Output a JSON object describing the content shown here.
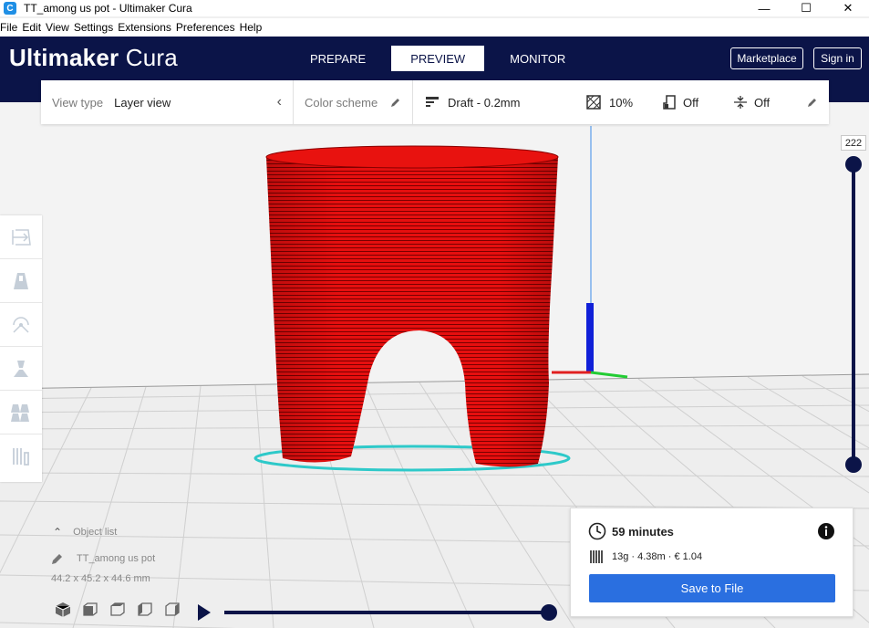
{
  "window": {
    "title": "TT_among us pot - Ultimaker Cura",
    "app_icon": "C",
    "controls": [
      "—",
      "☐",
      "✕"
    ]
  },
  "menu": [
    "File",
    "Edit",
    "View",
    "Settings",
    "Extensions",
    "Preferences",
    "Help"
  ],
  "header": {
    "logo_brand": "Ultimaker",
    "logo_product": "Cura",
    "tabs": [
      "PREPARE",
      "PREVIEW",
      "MONITOR"
    ],
    "active_tab": "PREVIEW",
    "marketplace_label": "Marketplace",
    "signin_label": "Sign in"
  },
  "settings_bar": {
    "view_type_label": "View type",
    "view_type_value": "Layer view",
    "color_scheme_label": "Color scheme",
    "profile": "Draft - 0.2mm",
    "infill": "10%",
    "support": "Off",
    "adhesion": "Off"
  },
  "layer_slider": {
    "current_layer": "222"
  },
  "object_list": {
    "header": "Object list",
    "object_name": "TT_among us pot",
    "dimensions": "44.2 x 45.2 x 44.6 mm"
  },
  "print_info": {
    "time": "59 minutes",
    "material": "13g · 4.38m · € 1.04",
    "save_label": "Save to File"
  },
  "colors": {
    "header_bg": "#0b1448",
    "accent_blue": "#2a6fe0",
    "model_red": "#e00d0d",
    "outline_cyan": "#2ec9c9"
  }
}
